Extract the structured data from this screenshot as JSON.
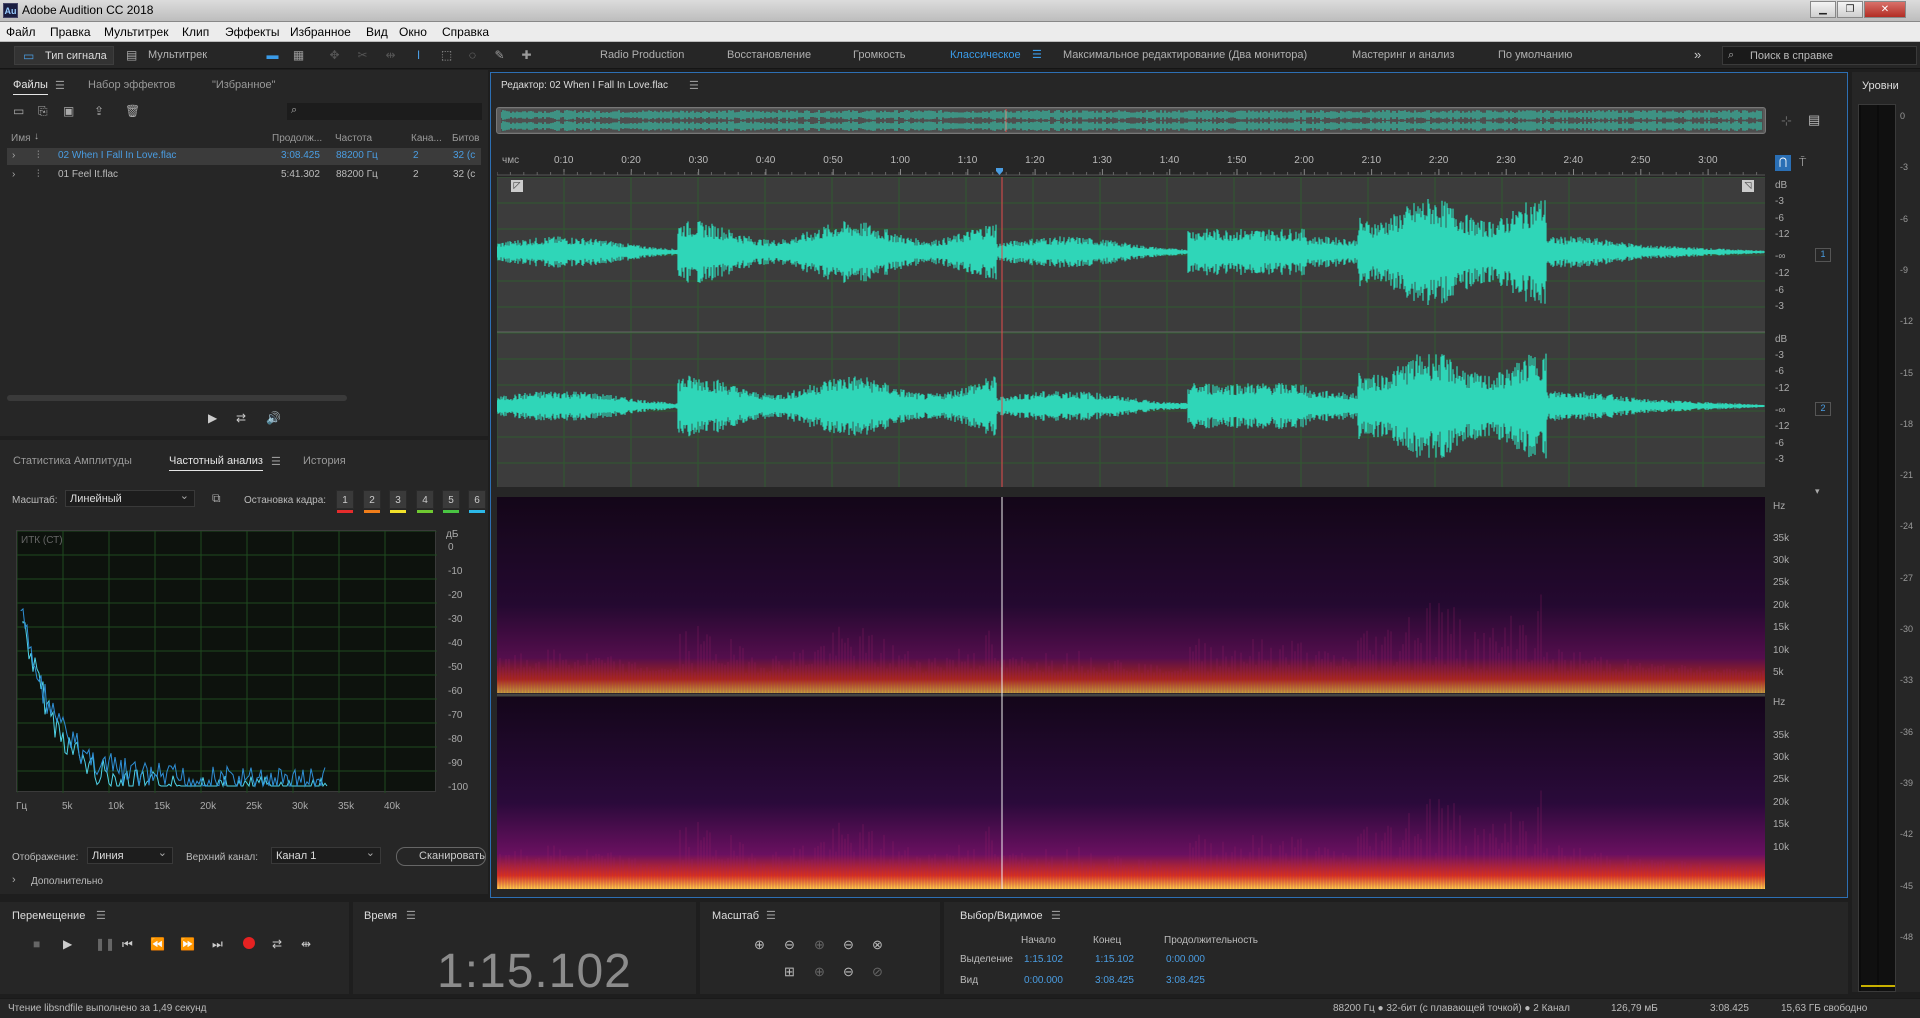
{
  "title": {
    "app_icon": "Au",
    "text": "Adobe Audition CC 2018"
  },
  "menu": [
    "Файл",
    "Правка",
    "Мультитрек",
    "Клип",
    "Эффекты",
    "Избранное",
    "Вид",
    "Окно",
    "Справка"
  ],
  "toolbar": {
    "waveform": "Тип сигнала",
    "multitrack": "Мультитрек"
  },
  "workspaces": [
    "Radio Production",
    "Восстановление",
    "Громкость",
    "Классическое",
    "Максимальное редактирование (Два монитора)",
    "Мастеринг и анализ",
    "По умолчанию"
  ],
  "active_workspace": "Классическое",
  "help_search_placeholder": "Поиск в справке",
  "files_panel": {
    "tabs": [
      "Файлы",
      "Набор эффектов",
      "\"Избранное\""
    ],
    "search_placeholder": "",
    "columns": [
      "Имя",
      "Продолж...",
      "Частота",
      "Кана...",
      "Битов"
    ],
    "rows": [
      {
        "name": "02 When I Fall In Love.flac",
        "duration": "3:08.425",
        "rate": "88200 Гц",
        "channels": "2",
        "bits": "32 (c"
      },
      {
        "name": "01 Feel It.flac",
        "duration": "5:41.302",
        "rate": "88200 Гц",
        "channels": "2",
        "bits": "32 (c"
      }
    ]
  },
  "analysis_panel": {
    "tabs": [
      "Статистика Амплитуды",
      "Частотный анализ",
      "История"
    ],
    "scale_label": "Масштаб:",
    "scale_value": "Линейный",
    "freeze_label": "Остановка кадра:",
    "freeze_buttons": [
      "1",
      "2",
      "3",
      "4",
      "5",
      "6"
    ],
    "freeze_colors": [
      "#e52c2c",
      "#f07d1a",
      "#f2e12a",
      "#6fc931",
      "#49c442",
      "#2cb9e8"
    ],
    "plot_caption": "ИТК (СТ)",
    "db_unit": "дБ",
    "db_ticks": [
      "0",
      "-10",
      "-20",
      "-30",
      "-40",
      "-50",
      "-60",
      "-70",
      "-80",
      "-90",
      "-100"
    ],
    "freq_ticks": [
      "Гц",
      "5k",
      "10k",
      "15k",
      "20k",
      "25k",
      "30k",
      "35k",
      "40k"
    ],
    "display_label": "Отображение:",
    "display_value": "Линия",
    "channel_label": "Верхний канал:",
    "channel_value": "Канал 1",
    "scan_button": "Сканировать",
    "advanced": "Дополнительно"
  },
  "editor": {
    "title": "Редактор: 02 When I Fall In Love.flac",
    "ruler_unit": "чмс",
    "ruler_labels": [
      "0:10",
      "0:20",
      "0:30",
      "0:40",
      "0:50",
      "1:00",
      "1:10",
      "1:20",
      "1:30",
      "1:40",
      "1:50",
      "2:00",
      "2:10",
      "2:20",
      "2:30",
      "2:40",
      "2:50",
      "3:00"
    ],
    "ch_db_labels": [
      "dB",
      "-3",
      "-6",
      "-12",
      "-∞",
      "-12",
      "-6",
      "-3"
    ],
    "channel_numbers": [
      "1",
      "2"
    ],
    "spec_labels": [
      "Hz",
      "35k",
      "30k",
      "25k",
      "20k",
      "15k",
      "10k",
      "5k"
    ]
  },
  "level_meter": {
    "title": "Уровни",
    "ticks": [
      "0",
      "-3",
      "-6",
      "-9",
      "-12",
      "-15",
      "-18",
      "-21",
      "-24",
      "-27",
      "-30",
      "-33",
      "-36",
      "-39",
      "-42",
      "-45",
      "-48"
    ]
  },
  "transport": {
    "title": "Перемещение"
  },
  "time": {
    "title": "Время",
    "value": "1:15.102"
  },
  "zoom": {
    "title": "Масштаб"
  },
  "selection": {
    "title": "Выбор/Видимое",
    "headers": [
      "Начало",
      "Конец",
      "Продолжительность"
    ],
    "rows": [
      {
        "label": "Выделение",
        "start": "1:15.102",
        "end": "1:15.102",
        "duration": "0:00.000"
      },
      {
        "label": "Вид",
        "start": "0:00.000",
        "end": "3:08.425",
        "duration": "3:08.425"
      }
    ]
  },
  "status": {
    "left": "Чтение libsndfile выполнено за 1,49 секунд",
    "format": "88200 Гц ● 32-бит (с плавающей точкой) ● 2 Канал",
    "size": "126,79 мБ",
    "duration": "3:08.425",
    "free": "15,63 ГБ свободно"
  },
  "colors": {
    "accent": "#3a9be8",
    "waveform": "#2fd6b8",
    "playhead": "#e34b4b",
    "record": "#e52222"
  }
}
